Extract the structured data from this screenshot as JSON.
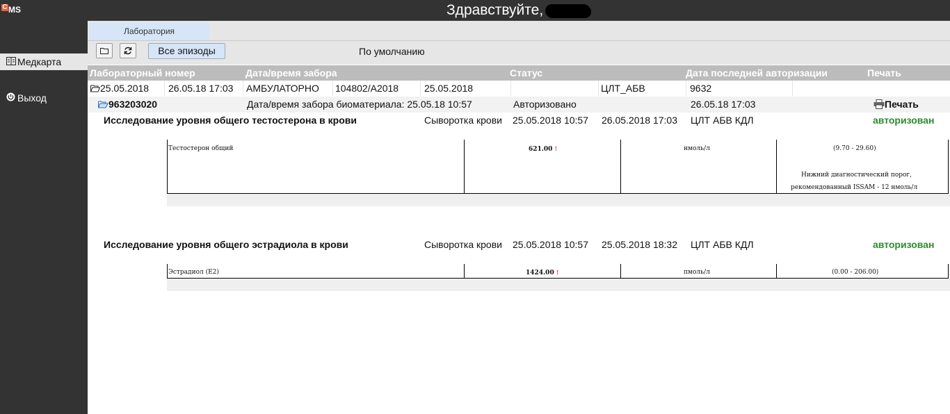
{
  "app": {
    "logo_mark": "C",
    "logo_text": "MS"
  },
  "sidebar": {
    "items": [
      {
        "label": "Медкарта",
        "icon": "medcard-icon"
      },
      {
        "label": "Выход",
        "icon": "power-icon"
      }
    ]
  },
  "header": {
    "greeting": "Здравствуйте,"
  },
  "tabs": [
    {
      "label": "Лаборатория"
    }
  ],
  "toolbar": {
    "episodes_label": "Все эпизоды",
    "default_label": "По умолчанию"
  },
  "columns": [
    "Лабораторный номер",
    "Дата/время забора",
    "Статус",
    "Дата последней авторизации",
    "Печать"
  ],
  "episode": {
    "date": "25.05.2018",
    "datetime": "26.05.18 17:03",
    "type": "АМБУЛАТОРНО",
    "code": "104802/A2018",
    "date2": "25.05.2018",
    "lab": "ЦЛТ_АБВ",
    "number": "9632"
  },
  "order": {
    "number": "963203020",
    "collection": "Дата/время забора биоматериала: 25.05.18 10:57",
    "status": "Авторизовано",
    "auth_date": "26.05.18 17:03",
    "print_label": "Печать"
  },
  "tests": [
    {
      "title": "Исследование уровня общего тестостерона в крови",
      "material": "Сыворотка крови",
      "collected": "25.05.2018 10:57",
      "authorized": "26.05.2018 17:03",
      "lab": "ЦЛТ АБВ КДЛ",
      "status": "авторизован",
      "result": {
        "name": "Тестостерон общий",
        "value": "621.00",
        "flag": "!",
        "unit": "нмоль/л",
        "range": "(9.70 - 29.60)",
        "note1": "Нижний диагностический порог,",
        "note2": "рекомендованный ISSAM - 12 нмоль/л"
      }
    },
    {
      "title": "Исследование уровня общего эстрадиола в крови",
      "material": "Сыворотка крови",
      "collected": "25.05.2018 10:57",
      "authorized": "25.05.2018 18:32",
      "lab": "ЦЛТ АБВ КДЛ",
      "status": "авторизован",
      "result": {
        "name": "Эстрадиол (E2)",
        "value": "1424.00",
        "flag": "!",
        "unit": "пмоль/л",
        "range": "(0.00 - 206.00)"
      }
    }
  ],
  "colors": {
    "sidebar_bg": "#333333",
    "status_ok": "#2e8b2e",
    "tab_active": "#d6e6f8",
    "header_row": "#bcbcbc"
  }
}
